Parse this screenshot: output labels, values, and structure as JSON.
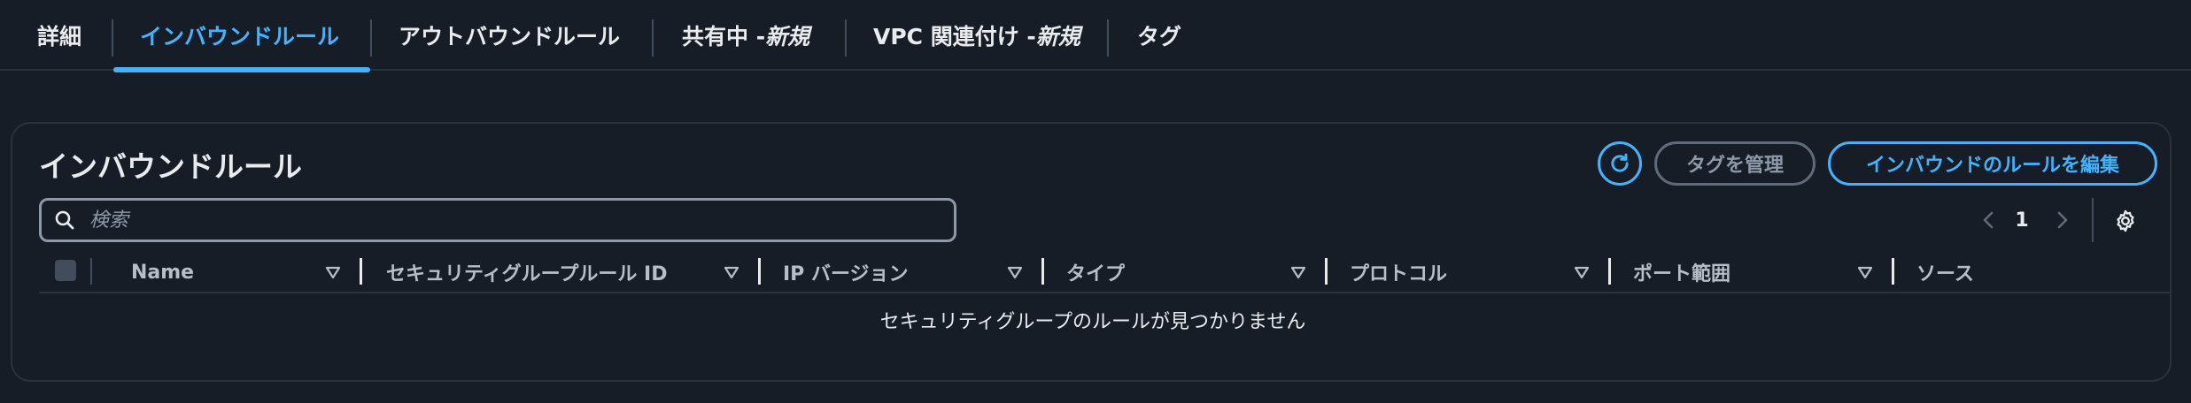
{
  "tabs": [
    {
      "label": "詳細",
      "suffix": ""
    },
    {
      "label": "インバウンドルール",
      "suffix": ""
    },
    {
      "label": "アウトバウンドルール",
      "suffix": ""
    },
    {
      "label": "共有中 - ",
      "suffix": "新規"
    },
    {
      "label": "VPC 関連付け - ",
      "suffix": "新規"
    },
    {
      "label": "タグ",
      "suffix": ""
    }
  ],
  "active_tab": "インバウンドルール",
  "panel": {
    "title": "インバウンドルール",
    "manage_tags_label": "タグを管理",
    "edit_rules_label": "インバウンドのルールを編集",
    "refresh_icon": "refresh-icon"
  },
  "search": {
    "placeholder": "検索",
    "value": ""
  },
  "pagination": {
    "current_page": "1"
  },
  "table": {
    "columns": [
      "Name",
      "セキュリティグループルール ID",
      "IP バージョン",
      "タイプ",
      "プロトコル",
      "ポート範囲",
      "ソース"
    ],
    "empty_message": "セキュリティグループのルールが見つかりません"
  },
  "colors": {
    "background": "#161d26",
    "accent": "#42b4ff",
    "text": "#e9ebed",
    "muted": "#8d99a8"
  }
}
